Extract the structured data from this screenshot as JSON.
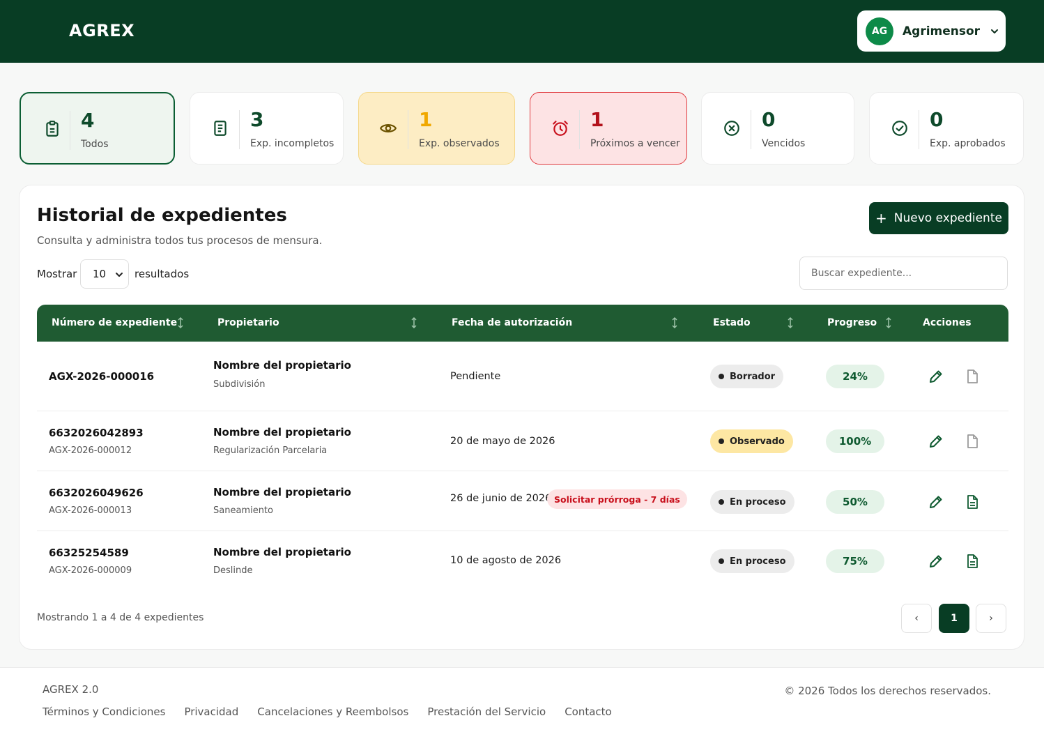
{
  "header": {
    "logo": "AGREX",
    "user": {
      "initials": "AG",
      "name": "Agrimensor"
    }
  },
  "stats": [
    {
      "value": "4",
      "label": "Todos",
      "icon": "clipboard-icon"
    },
    {
      "value": "3",
      "label": "Exp. incompletos",
      "icon": "document-icon"
    },
    {
      "value": "1",
      "label": "Exp. observados",
      "icon": "eye-icon"
    },
    {
      "value": "1",
      "label": "Próximos a vencer",
      "icon": "alarm-clock-icon"
    },
    {
      "value": "0",
      "label": "Vencidos",
      "icon": "x-circle-icon"
    },
    {
      "value": "0",
      "label": "Exp. aprobados",
      "icon": "check-circle-icon"
    }
  ],
  "panel": {
    "title": "Historial de expedientes",
    "subtitle": "Consulta y administra todos tus procesos de mensura.",
    "new_button": "Nuevo expediente",
    "show_label": "Mostrar",
    "show_value": "10",
    "results_label": "resultados",
    "search_placeholder": "Buscar expediente..."
  },
  "table": {
    "columns": [
      "Número de expediente",
      "Propietario",
      "Fecha de autorización",
      "Estado",
      "Progreso",
      "Acciones"
    ],
    "rows": [
      {
        "number": "AGX-2026-000016",
        "code": "",
        "owner": "Nombre del propietario",
        "type": "Subdivisión",
        "date": "Pendiente",
        "extension": "",
        "status": "Borrador",
        "progress": "24%"
      },
      {
        "number": "6632026042893",
        "code": "AGX-2026-000012",
        "owner": "Nombre del propietario",
        "type": "Regularización Parcelaria",
        "date": "20 de mayo de 2026",
        "extension": "",
        "status": "Observado",
        "progress": "100%"
      },
      {
        "number": "6632026049626",
        "code": "AGX-2026-000013",
        "owner": "Nombre del propietario",
        "type": "Saneamiento",
        "date": "26 de junio de 2026",
        "extension": "Solicitar prórroga - 7 días",
        "status": "En proceso",
        "progress": "50%"
      },
      {
        "number": "66325254589",
        "code": "AGX-2026-000009",
        "owner": "Nombre del propietario",
        "type": "Deslinde",
        "date": "10 de agosto de 2026",
        "extension": "",
        "status": "En proceso",
        "progress": "75%"
      }
    ]
  },
  "pagination": {
    "summary": "Mostrando 1 a 4 de 4 expedientes",
    "prev": "‹",
    "current": "1",
    "next": "›"
  },
  "footer": {
    "brand": "AGREX 2.0",
    "copyright": "© 2026 Todos los derechos reservados.",
    "links": [
      "Términos y Condiciones",
      "Privacidad",
      "Cancelaciones y Reembolsos",
      "Prestación del Servicio",
      "Contacto"
    ]
  },
  "colors": {
    "brand_dark": "#083d24",
    "table_header": "#1f5b32",
    "warning": "#f0a800",
    "danger": "#b3111b"
  }
}
